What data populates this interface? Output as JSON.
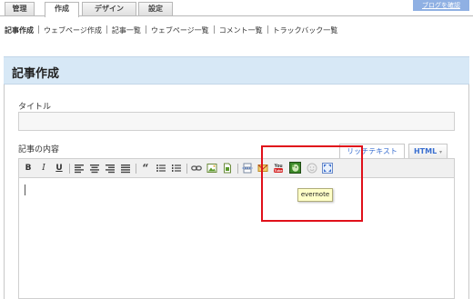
{
  "top_tabs": [
    {
      "label": "管理",
      "active": false
    },
    {
      "label": "作成",
      "active": true
    },
    {
      "label": "デザイン",
      "active": false
    },
    {
      "label": "設定",
      "active": false
    }
  ],
  "blog_button": "ブログを確認",
  "subnav": [
    "記事作成",
    "ウェブページ作成",
    "記事一覧",
    "ウェブページ一覧",
    "コメント一覧",
    "トラックバック一覧"
  ],
  "page_title": "記事作成",
  "form": {
    "title_label": "タイトル",
    "title_value": "",
    "body_label": "記事の内容",
    "body_value": ""
  },
  "editor_tabs": {
    "rich": "リッチテキスト",
    "html": "HTML",
    "html_arrow": "▾"
  },
  "toolbar": {
    "bold": "B",
    "italic": "I",
    "underline": "U",
    "quote": "“"
  },
  "tooltip": "evernote",
  "colors": {
    "header_bg": "#d7e8f6",
    "highlight": "#e0101a",
    "link_blue": "#3a6fd0",
    "evernote_green": "#3d8a2a"
  }
}
